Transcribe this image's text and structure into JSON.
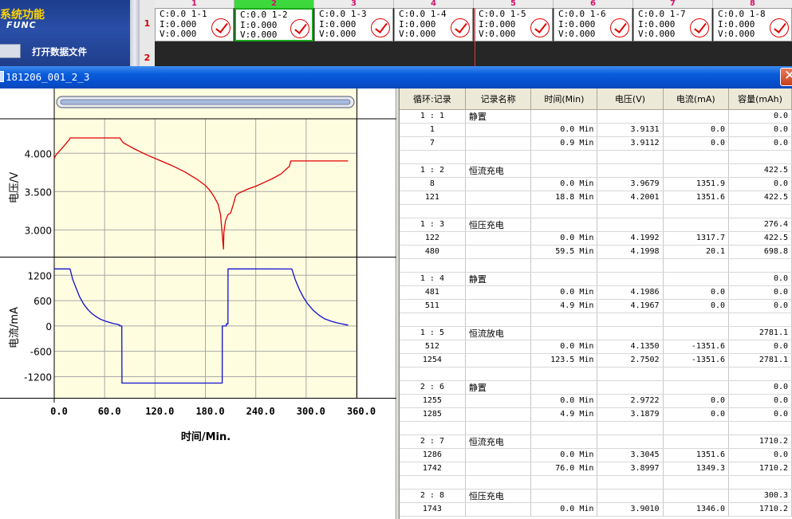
{
  "func_panel": {
    "title": "系统功能",
    "subtitle": "FUNC",
    "open_button_label": "打开数据文件",
    "icon": "folder-icon"
  },
  "channel_grid": {
    "columns": [
      "1",
      "2",
      "3",
      "4",
      "5",
      "6",
      "7",
      "8"
    ],
    "selected_column": "2",
    "rows": [
      "1",
      "2"
    ],
    "cells": [
      {
        "c": "C:0.0 1-1",
        "i": "I:0.000",
        "v": "V:0.000"
      },
      {
        "c": "C:0.0 1-2",
        "i": "I:0.000",
        "v": "V:0.000"
      },
      {
        "c": "C:0.0 1-3",
        "i": "I:0.000",
        "v": "V:0.000"
      },
      {
        "c": "C:0.0 1-4",
        "i": "I:0.000",
        "v": "V:0.000"
      },
      {
        "c": "C:0.0 1-5",
        "i": "I:0.000",
        "v": "V:0.000"
      },
      {
        "c": "C:0.0 1-6",
        "i": "I:0.000",
        "v": "V:0.000"
      },
      {
        "c": "C:0.0 1-7",
        "i": "I:0.000",
        "v": "V:0.000"
      },
      {
        "c": "C:0.0 1-8",
        "i": "I:0.000",
        "v": "V:0.000"
      }
    ],
    "status_icon": "check-circle-icon",
    "colors": {
      "selected_header": "#3cd83c",
      "header_text": "#d4146a",
      "check": "#e00000"
    }
  },
  "window": {
    "title": "181206_001_2_3",
    "close_icon": "close-icon"
  },
  "chart_data": [
    {
      "type": "line",
      "ylabel": "电压/V",
      "xlabel": "时间/Min.",
      "ylim": [
        2.65,
        4.45
      ],
      "xlim": [
        0,
        360
      ],
      "y_ticks": [
        "4.000",
        "3.500",
        "3.000"
      ],
      "y_tick_values": [
        4.0,
        3.5,
        3.0
      ],
      "color": "#e00000",
      "grid": true,
      "series": [
        {
          "x": [
            0,
            1,
            3,
            8,
            12,
            15,
            18,
            18.8,
            30,
            50,
            60,
            70,
            78.2,
            80,
            82,
            85,
            95,
            110,
            125,
            140,
            155,
            170,
            180,
            185,
            190,
            195,
            198,
            200,
            201.6,
            202,
            204,
            207,
            210,
            213,
            215,
            216,
            217,
            220,
            230,
            240,
            250,
            260,
            270,
            280,
            281.7,
            290,
            300,
            320,
            340,
            350
          ],
          "y": [
            3.93,
            3.96,
            3.99,
            4.05,
            4.1,
            4.14,
            4.18,
            4.2,
            4.2,
            4.2,
            4.2,
            4.2,
            4.2,
            4.17,
            4.14,
            4.12,
            4.06,
            3.98,
            3.91,
            3.84,
            3.76,
            3.66,
            3.58,
            3.52,
            3.44,
            3.34,
            3.2,
            2.95,
            2.75,
            2.97,
            3.12,
            3.2,
            3.22,
            3.32,
            3.4,
            3.44,
            3.46,
            3.48,
            3.53,
            3.57,
            3.62,
            3.67,
            3.73,
            3.83,
            3.9,
            3.9,
            3.9,
            3.9,
            3.9,
            3.9
          ]
        }
      ]
    },
    {
      "type": "line",
      "ylabel": "电流/mA",
      "xlabel": "时间/Min.",
      "ylim": [
        -1700,
        1620
      ],
      "xlim": [
        0,
        360
      ],
      "y_ticks": [
        "1200",
        "600",
        "0",
        "-600",
        "-1200"
      ],
      "y_tick_values": [
        1200,
        600,
        0,
        -600,
        -1200
      ],
      "x_ticks": [
        "0.0",
        "60.0",
        "120.0",
        "180.0",
        "240.0",
        "300.0",
        "360.0"
      ],
      "x_tick_values": [
        0,
        60,
        120,
        180,
        240,
        300,
        360
      ],
      "color": "#1010d0",
      "grid": true,
      "series": [
        {
          "x": [
            0,
            18.8,
            22,
            26,
            30,
            35,
            40,
            45,
            50,
            55,
            60,
            65,
            70,
            75,
            78,
            78.1,
            80.5,
            80.6,
            200,
            200.1,
            204.9,
            205,
            206.9,
            207,
            283,
            287,
            292,
            297,
            302,
            308,
            315,
            322,
            330,
            338,
            345,
            350
          ],
          "y": [
            1351,
            1351,
            1100,
            900,
            700,
            520,
            390,
            290,
            220,
            160,
            120,
            90,
            60,
            40,
            20,
            0,
            0,
            -1351,
            -1351,
            0,
            0,
            50,
            50,
            1351,
            1349,
            1100,
            860,
            670,
            520,
            380,
            260,
            170,
            110,
            70,
            40,
            20
          ]
        }
      ]
    },
    {
      "type": "table",
      "columns": [
        "循环:记录",
        "记录名称",
        "时间(Min)",
        "电压(V)",
        "电流(mA)",
        "容量(mAh)"
      ],
      "rows": [
        [
          "1 : 1",
          "静置",
          "",
          "",
          "",
          "0.0"
        ],
        [
          "1",
          "",
          "0.0 Min",
          "3.9131",
          "0.0",
          "0.0"
        ],
        [
          "7",
          "",
          "0.9 Min",
          "3.9112",
          "0.0",
          "0.0"
        ],
        [
          "",
          "",
          "",
          "",
          "",
          ""
        ],
        [
          "1 : 2",
          "恒流充电",
          "",
          "",
          "",
          "422.5"
        ],
        [
          "8",
          "",
          "0.0 Min",
          "3.9679",
          "1351.9",
          "0.0"
        ],
        [
          "121",
          "",
          "18.8 Min",
          "4.2001",
          "1351.6",
          "422.5"
        ],
        [
          "",
          "",
          "",
          "",
          "",
          ""
        ],
        [
          "1 : 3",
          "恒压充电",
          "",
          "",
          "",
          "276.4"
        ],
        [
          "122",
          "",
          "0.0 Min",
          "4.1992",
          "1317.7",
          "422.5"
        ],
        [
          "480",
          "",
          "59.5 Min",
          "4.1998",
          "20.1",
          "698.8"
        ],
        [
          "",
          "",
          "",
          "",
          "",
          ""
        ],
        [
          "1 : 4",
          "静置",
          "",
          "",
          "",
          "0.0"
        ],
        [
          "481",
          "",
          "0.0 Min",
          "4.1986",
          "0.0",
          "0.0"
        ],
        [
          "511",
          "",
          "4.9 Min",
          "4.1967",
          "0.0",
          "0.0"
        ],
        [
          "",
          "",
          "",
          "",
          "",
          ""
        ],
        [
          "1 : 5",
          "恒流放电",
          "",
          "",
          "",
          "2781.1"
        ],
        [
          "512",
          "",
          "0.0 Min",
          "4.1350",
          "-1351.6",
          "0.0"
        ],
        [
          "1254",
          "",
          "123.5 Min",
          "2.7502",
          "-1351.6",
          "2781.1"
        ],
        [
          "",
          "",
          "",
          "",
          "",
          ""
        ],
        [
          "2 : 6",
          "静置",
          "",
          "",
          "",
          "0.0"
        ],
        [
          "1255",
          "",
          "0.0 Min",
          "2.9722",
          "0.0",
          "0.0"
        ],
        [
          "1285",
          "",
          "4.9 Min",
          "3.1879",
          "0.0",
          "0.0"
        ],
        [
          "",
          "",
          "",
          "",
          "",
          ""
        ],
        [
          "2 : 7",
          "恒流充电",
          "",
          "",
          "",
          "1710.2"
        ],
        [
          "1286",
          "",
          "0.0 Min",
          "3.3045",
          "1351.6",
          "0.0"
        ],
        [
          "1742",
          "",
          "76.0 Min",
          "3.8997",
          "1349.3",
          "1710.2"
        ],
        [
          "",
          "",
          "",
          "",
          "",
          ""
        ],
        [
          "2 : 8",
          "恒压充电",
          "",
          "",
          "",
          "300.3"
        ],
        [
          "1743",
          "",
          "0.0 Min",
          "3.9010",
          "1346.0",
          "1710.2"
        ]
      ]
    }
  ]
}
